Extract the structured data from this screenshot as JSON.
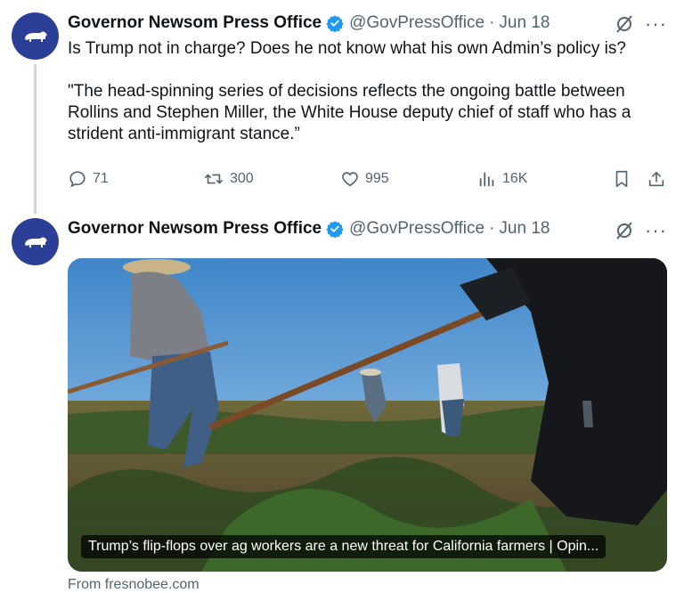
{
  "tweets": [
    {
      "name": "Governor Newsom Press Office",
      "handle": "@GovPressOffice",
      "dot": "·",
      "date": "Jun 18",
      "more": "···",
      "text1": "Is Trump not in charge? Does he not know what his own Admin’s policy is?",
      "text2": "\"The head-spinning series of decisions reflects the ongoing battle between Rollins and Stephen Miller, the White House deputy chief of staff who has a strident anti-immigrant stance.”",
      "replies": "71",
      "retweets": "300",
      "likes": "995",
      "views": "16K"
    },
    {
      "name": "Governor Newsom Press Office",
      "handle": "@GovPressOffice",
      "dot": "·",
      "date": "Jun 18",
      "more": "···",
      "card_caption": "Trump’s flip-flops over ag workers are a new threat for California farmers | Opin...",
      "source": "From fresnobee.com"
    }
  ],
  "icons": {
    "avatar": "bear-icon",
    "verified": "verified-badge-icon",
    "grok": "grok-icon",
    "reply": "reply-icon",
    "retweet": "retweet-icon",
    "like": "heart-icon",
    "views": "views-icon",
    "bookmark": "bookmark-icon",
    "share": "share-icon"
  },
  "colors": {
    "avatar_bg": "#2c3f97",
    "verified": "#1d9bf0",
    "secondary_text": "#536471"
  }
}
